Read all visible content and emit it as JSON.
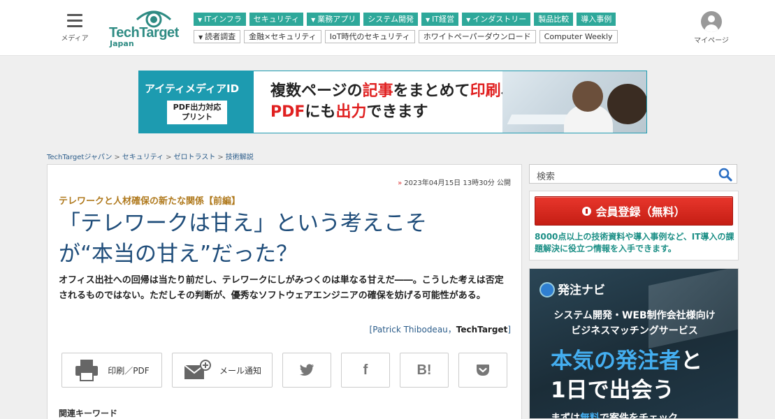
{
  "header": {
    "menu_label": "メディア",
    "logo_text": "TechTarget",
    "logo_sub": "Japan",
    "mypage_label": "マイページ",
    "nav_row1": [
      {
        "label": "ITインフラ",
        "dropdown": true
      },
      {
        "label": "セキュリティ",
        "dropdown": false
      },
      {
        "label": "業務アプリ",
        "dropdown": true
      },
      {
        "label": "システム開発",
        "dropdown": false
      },
      {
        "label": "IT経営",
        "dropdown": true
      },
      {
        "label": "インダストリー",
        "dropdown": true
      },
      {
        "label": "製品比較",
        "dropdown": false
      },
      {
        "label": "導入事例",
        "dropdown": false
      }
    ],
    "nav_row2": [
      {
        "label": "読者調査",
        "dropdown": true
      },
      {
        "label": "金融×セキュリティ",
        "dropdown": false
      },
      {
        "label": "IoT時代のセキュリティ",
        "dropdown": false
      },
      {
        "label": "ホワイトペーパーダウンロード",
        "dropdown": false
      },
      {
        "label": "Computer Weekly",
        "dropdown": false
      }
    ]
  },
  "banner": {
    "brand": "アイティメディアID",
    "box_line1": "PDF出力対応",
    "box_line2": "プリント",
    "copy1_a": "複数ページの",
    "copy1_b": "記事",
    "copy1_c": "をまとめて",
    "copy1_d": "印刷",
    "copy1_e": "、",
    "copy2_a": "PDF",
    "copy2_b": "にも",
    "copy2_c": "出力",
    "copy2_d": "できます"
  },
  "breadcrumb": [
    "TechTargetジャパン",
    "セキュリティ",
    "ゼロトラスト",
    "技術解説"
  ],
  "article": {
    "date": "2023年04月15日 13時30分 公開",
    "series": "テレワークと人材確保の新たな関係【前編】",
    "title_line1": "「テレワークは甘え」という考えこそ",
    "title_line2": "が“本当の甘え”だった？",
    "lead": "オフィス出社への回帰は当たり前だし、テレワークにしがみつくのは単なる甘えだ――。こうした考えは否定されるものではない。ただしその判断が、優秀なソフトウェアエンジニアの確保を妨げる可能性がある。",
    "byline_open": "[",
    "byline_author": "Patrick Thibodeau",
    "byline_sep": "，",
    "byline_pub": "TechTarget",
    "byline_close": "]",
    "share": {
      "print_label": "印刷／PDF",
      "mail_label": "メール通知",
      "twitter_icon": "twitter-icon",
      "facebook_glyph": "f",
      "hatena_glyph": "B!",
      "pocket_icon": "pocket-icon"
    },
    "related_label": "関連キーワード"
  },
  "sidebar": {
    "search_placeholder": "検索",
    "register_label": "会員登録（無料）",
    "register_text": "8000点以上の技術資料や導入事例など、IT導入の課題解決に役立つ情報を入手できます。",
    "ad": {
      "brand": "発注ナビ",
      "line1": "システム開発・WEB制作会社様向け",
      "line2": "ビジネスマッチングサービス",
      "line3_a": "本気の",
      "line3_b": "発注者",
      "line3_c": "と",
      "line4": "1日で出会う",
      "line5_a": "まずは",
      "line5_b": "無料",
      "line5_c": "で案件をチェック"
    }
  },
  "colors": {
    "accent": "#2ea89a",
    "title": "#1f4d7a",
    "series": "#b07a1e",
    "register": "#d42a20",
    "link": "#2b5c8a"
  }
}
